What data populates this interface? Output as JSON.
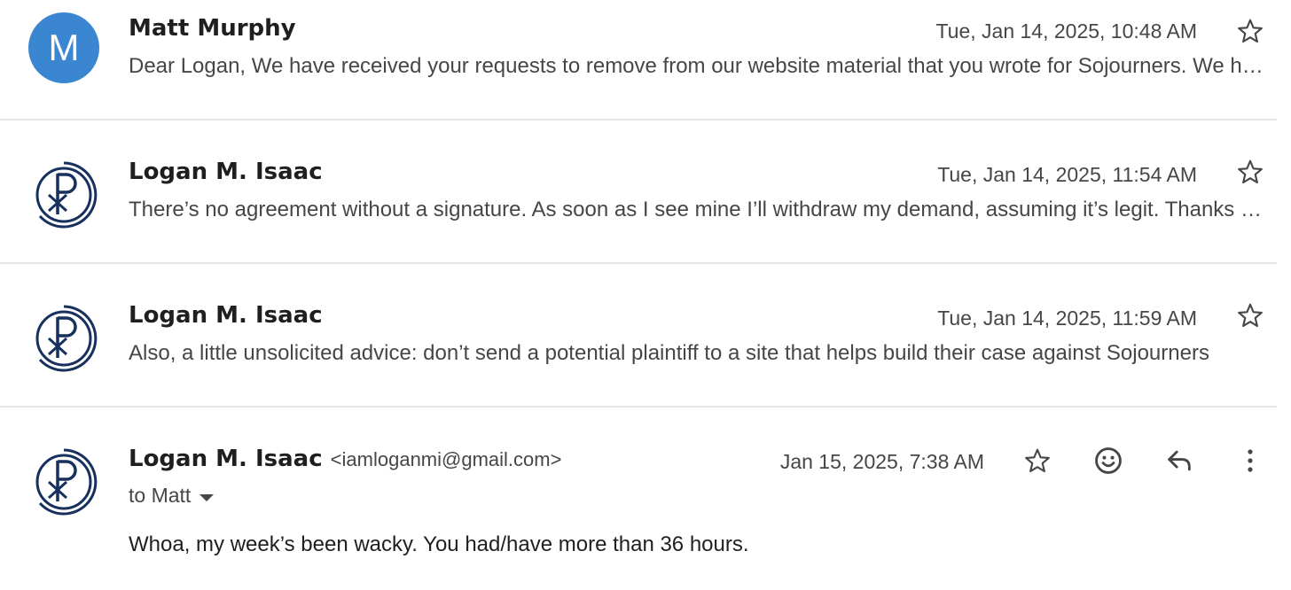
{
  "messages": [
    {
      "avatar_letter": "M",
      "sender": "Matt Murphy",
      "date": "Tue, Jan 14, 2025, 10:48 AM",
      "snippet": "Dear Logan, We have received your requests to remove from our website material that you wrote for Sojourners. We have attempted to reach you by phone",
      "icon": "star-icon"
    },
    {
      "avatar_icon": "chi-rho-logo-icon",
      "sender": "Logan M. Isaac",
      "date": "Tue, Jan 14, 2025, 11:54 AM",
      "snippet": "There’s no agreement without a signature. As soon as I see mine I’ll withdraw my demand, assuming it’s legit. Thanks for reaching out",
      "icon": "star-icon"
    },
    {
      "avatar_icon": "chi-rho-logo-icon",
      "sender": "Logan M. Isaac",
      "date": "Tue, Jan 14, 2025, 11:59 AM",
      "snippet": "Also, a little unsolicited advice: don’t send a potential plaintiff to a site that helps build their case against Sojourners",
      "icon": "star-icon"
    }
  ],
  "open_message": {
    "avatar_icon": "chi-rho-logo-icon",
    "sender": "Logan M. Isaac",
    "email": "<iamloganmi@gmail.com>",
    "date": "Jan 15, 2025, 7:38 AM",
    "recipient": "to Matt",
    "body": "Whoa, my week’s been wacky. You had/have more than 36 hours.",
    "action_icons": [
      "star-icon",
      "emoji-icon",
      "reply-icon",
      "more-vert-icon"
    ]
  },
  "colors": {
    "avatar_blue": "#3b86d1",
    "logo_navy": "#17305e",
    "secondary_text": "#444746",
    "primary_text": "#1f1f1f",
    "divider": "#e6e6e6"
  }
}
